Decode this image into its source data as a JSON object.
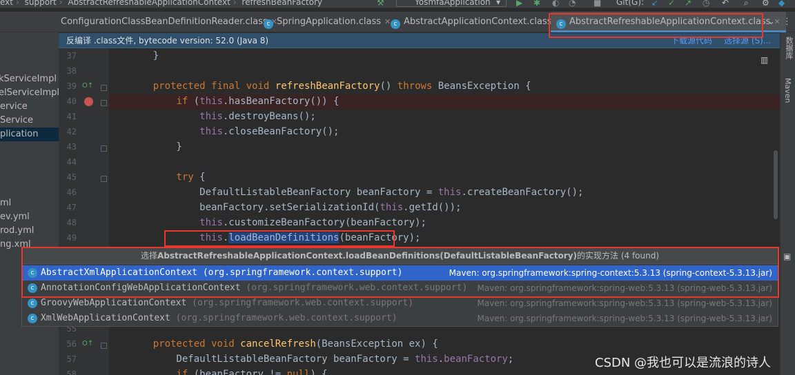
{
  "navbar": {
    "crumbs": [
      "ext",
      "support",
      "AbstractRefreshableApplicationContext",
      "refreshBeanFactory"
    ],
    "run_config": "YosmfaApplication",
    "git_label": "Git(G):"
  },
  "tabs": [
    {
      "label": "ConfigurationClassBeanDefinitionReader.class"
    },
    {
      "label": "SpringApplication.class"
    },
    {
      "label": "AbstractApplicationContext.class"
    },
    {
      "label": "AbstractRefreshableApplicationContext.class"
    }
  ],
  "project_tree": [
    "kServiceImpl",
    "elServiceImpl",
    "ervice",
    "Service",
    "plication",
    "ml",
    "ev.yml",
    "rod.yml",
    "ng.xml"
  ],
  "banner": {
    "text": "反编译 .class文件, bytecode version: 52.0 (Java 8)",
    "download_link": "下载源代码",
    "choose_link": "选择源 (S)..."
  },
  "right_strip": {
    "database": "数据库",
    "maven": "Maven"
  },
  "code_lines": [
    {
      "n": "37",
      "text": "    }"
    },
    {
      "n": "38",
      "text": ""
    },
    {
      "n": "39",
      "text": "    protected final void refreshBeanFactory() throws BeansException {"
    },
    {
      "n": "40",
      "text": "        if (this.hasBeanFactory()) {"
    },
    {
      "n": "41",
      "text": "            this.destroyBeans();"
    },
    {
      "n": "42",
      "text": "            this.closeBeanFactory();"
    },
    {
      "n": "43",
      "text": "        }"
    },
    {
      "n": "44",
      "text": ""
    },
    {
      "n": "45",
      "text": "        try {"
    },
    {
      "n": "46",
      "text": "            DefaultListableBeanFactory beanFactory = this.createBeanFactory();"
    },
    {
      "n": "47",
      "text": "            beanFactory.setSerializationId(this.getId());"
    },
    {
      "n": "48",
      "text": "            this.customizeBeanFactory(beanFactory);"
    },
    {
      "n": "49",
      "text": "            this.loadBeanDefinitions(beanFactory);"
    },
    {
      "n": "55",
      "text": ""
    },
    {
      "n": "56",
      "text": "    protected void cancelRefresh(BeansException ex) {"
    },
    {
      "n": "57",
      "text": "        DefaultListableBeanFactory beanFactory = this.beanFactory;"
    },
    {
      "n": "58",
      "text": "        if (beanFactory != null) {"
    }
  ],
  "popup": {
    "title_prefix": "选择",
    "title_bold": "AbstractRefreshableApplicationContext.loadBeanDefinitions(DefaultListableBeanFactory)",
    "title_suffix": "的实现方法 (4 found)",
    "rows": [
      {
        "cls": "AbstractXmlApplicationContext",
        "pkg": "(org.springframework.context.support)",
        "maven": "Maven: org.springframework:spring-context:5.3.13 (spring-context-5.3.13.jar)"
      },
      {
        "cls": "AnnotationConfigWebApplicationContext",
        "pkg": "(org.springframework.web.context.support)",
        "maven": "Maven: org.springframework:spring-web:5.3.13 (spring-web-5.3.13.jar)"
      },
      {
        "cls": "GroovyWebApplicationContext",
        "pkg": "(org.springframework.web.context.support)",
        "maven": "Maven: org.springframework:spring-web:5.3.13 (spring-web-5.3.13.jar)"
      },
      {
        "cls": "XmlWebApplicationContext",
        "pkg": "(org.springframework.web.context.support)",
        "maven": "Maven: org.springframework:spring-web:5.3.13 (spring-web-5.3.13.jar)"
      }
    ]
  },
  "watermark": "CSDN @我也可以是流浪的诗人",
  "colors": {
    "accent_selection": "#2f65ca",
    "annotation_red": "#e8372d",
    "keyword": "#cc7832",
    "method": "#ffc66d",
    "this": "#9876aa"
  }
}
